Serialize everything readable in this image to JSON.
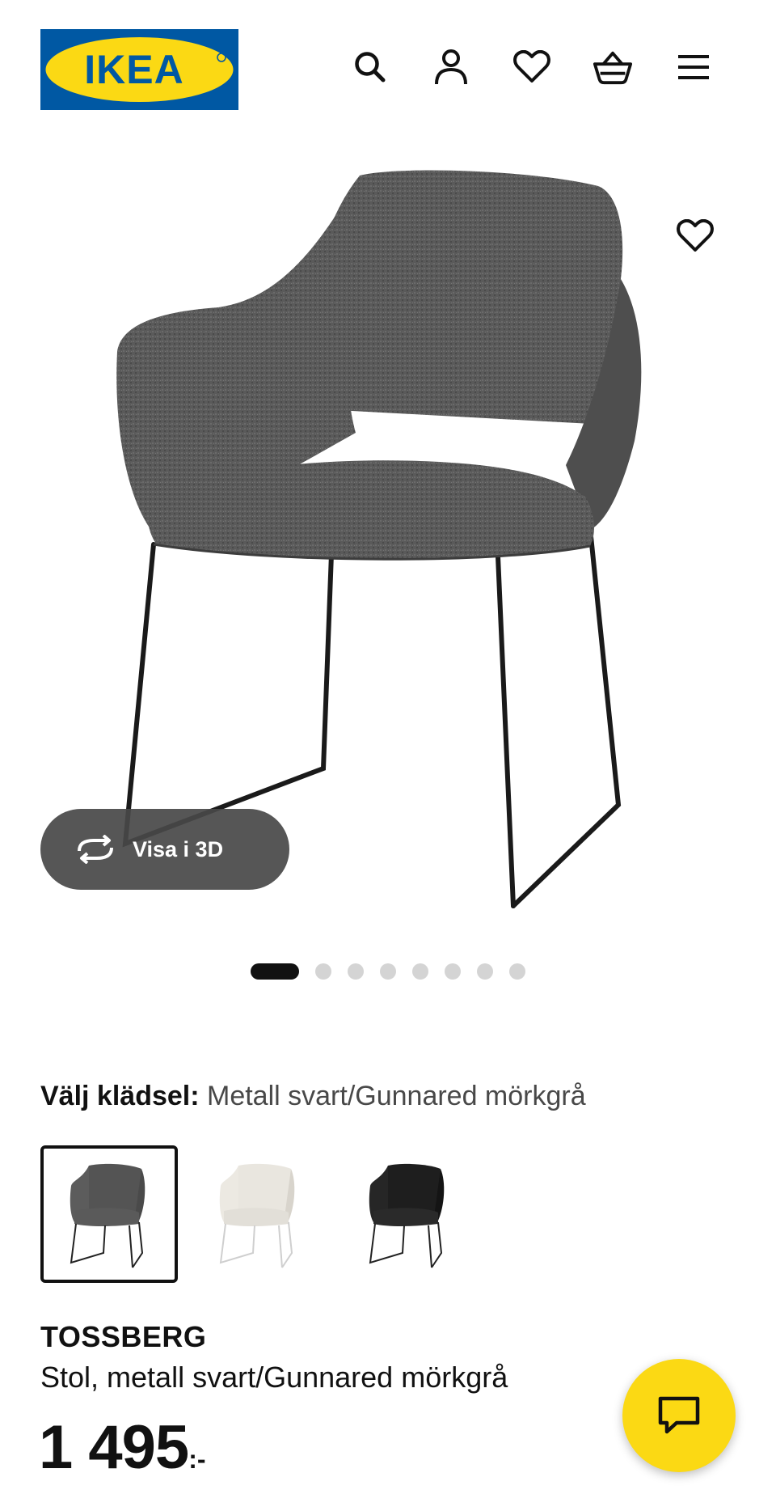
{
  "header": {
    "logo_text": "IKEA",
    "icons": [
      "search-icon",
      "user-icon",
      "heart-icon",
      "basket-icon",
      "menu-icon"
    ]
  },
  "gallery": {
    "view_3d_label": "Visa i 3D",
    "total_images": 8,
    "active_image": 1,
    "favourite_icon": "heart-icon"
  },
  "variant": {
    "label": "Välj klädsel:",
    "value": "Metall svart/Gunnared mörkgrå",
    "options": [
      {
        "color": "#545454",
        "selected": true
      },
      {
        "color": "#e6e3dc",
        "selected": false
      },
      {
        "color": "#1e1e1e",
        "selected": false
      }
    ]
  },
  "product": {
    "name": "TOSSBERG",
    "description": "Stol, metall svart/Gunnared mörkgrå",
    "price": "1 495",
    "currency": ":-"
  },
  "colors": {
    "ikea_blue": "#0058a3",
    "ikea_yellow": "#fbd914",
    "chat_yellow": "#fbd914"
  }
}
